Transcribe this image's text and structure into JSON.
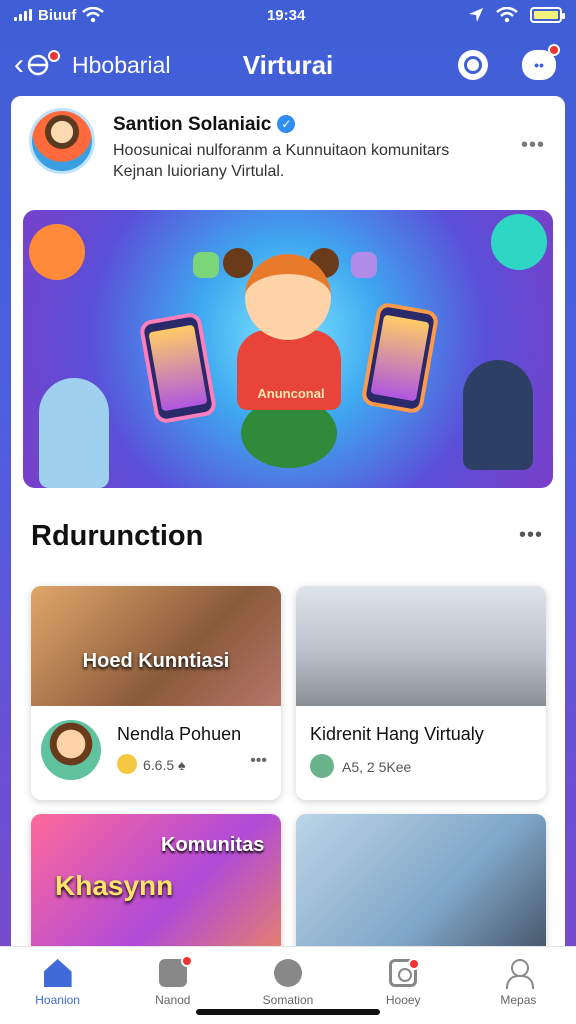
{
  "status_bar": {
    "carrier": "Biuuf",
    "time": "19:34"
  },
  "nav": {
    "left_title": "Hbobarial",
    "title": "Virturai"
  },
  "post": {
    "author": "Santion Solaniaic",
    "text": "Hoosunicai nulforanm a Kunnuitaon komunitars Kejnan luioriany Virtulal."
  },
  "hero": {
    "banner_text": "Anunconal"
  },
  "section": {
    "title": "Rdurunction"
  },
  "cards": [
    {
      "image_text": "Hoed Kunntiasi",
      "title": "Nendla Pohuen",
      "meta": "6.6.5 ♠"
    },
    {
      "title": "Kidrenit Hang Virtualy",
      "meta": "A5, 2 5Kee"
    },
    {
      "image_text": "Komunitas",
      "image_text_2": "Khasynn"
    },
    {}
  ],
  "tabs": [
    {
      "label": "Hoanion",
      "icon": "home-icon",
      "active": true
    },
    {
      "label": "Nanod",
      "icon": "people-icon",
      "badge": true
    },
    {
      "label": "Somation",
      "icon": "circle-icon"
    },
    {
      "label": "Hooey",
      "icon": "media-icon",
      "badge": true
    },
    {
      "label": "Mepas",
      "icon": "profile-icon"
    }
  ],
  "colors": {
    "accent": "#3f6ad8",
    "header_bg": "#3f5fd6",
    "badge": "#e33333"
  }
}
